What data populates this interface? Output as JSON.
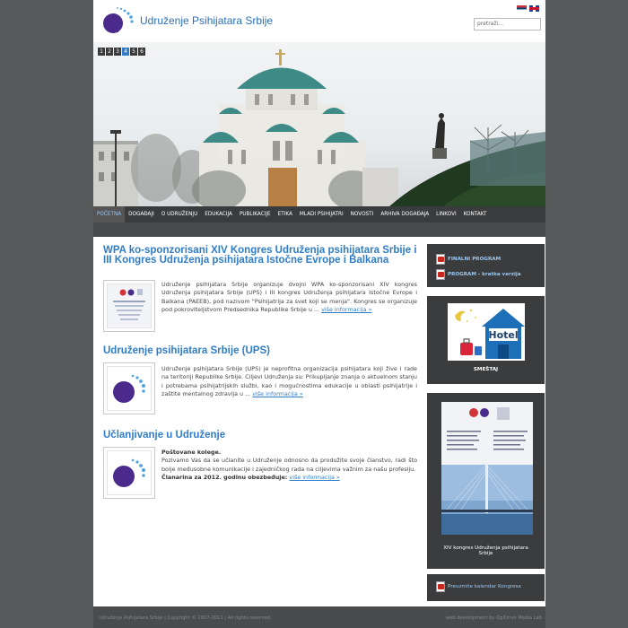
{
  "header": {
    "site_title": "Udruženje Psihijatara Srbije",
    "search_placeholder": "pretraži..."
  },
  "slider": {
    "numbers": [
      "1",
      "2",
      "3",
      "4",
      "5",
      "6"
    ],
    "active_index": 3
  },
  "nav": {
    "items": [
      "POČETNA",
      "DOGAĐAJI",
      "O UDRUŽENJU",
      "EDUKACIJA",
      "PUBLIKACIJE",
      "ETIKA",
      "MLADI PSIHIJATRI",
      "NOVOSTI",
      "ARHIVA DOGAĐAJA",
      "LINKOVI",
      "KONTAKT"
    ],
    "active": "POČETNA"
  },
  "articles": [
    {
      "title": "WPA ko-sponzorisani XIV Kongres Udruženja psihijatara Srbije i III Kongres Udruženja psihijatara Istočne Evrope i Balkana",
      "body": "Udruženje psihijatara Srbije organizuje dvojni WPA ko-sponzorisani XIV kongres Udruženja psihijatara Srbije (UPS) i III kongres Udruženja psihijatara Istočne Evrope i Balkana (PAEEB), pod nazivom \"Psihijatrija za svet koji se menja\". Kongres se organizuje pod pokroviteljstvom Predsednika Republike Srbije u ...",
      "more": "više informacija »"
    },
    {
      "title": "Udruženje psihijatara Srbije (UPS)",
      "body": "Udruženje psihijatara Srbije (UPS) je neprofitna organizacija psihijatara koji žive i rade na teritoriji Republike Srbije. Ciljevi Udruženja su: Prikupljanje znanja o aktuelnom stanju i potrebama psihijatrijskih službi, kao i mogućnostima edukacije u oblasti psihijatrije i zaštite mentalnog zdravlja u ...",
      "more": "više informacija »"
    },
    {
      "title": "Učlanjivanje u Udruženje",
      "greeting": "Poštovane kolege.",
      "body": "Pozivamo Vas da se učlanite u Udruženje odnosno da produžite svoje članstvo, radi što bolje međusobne komunikacije i zajedničkog rada na ciljevima važnim za našu profesiju.",
      "fee_label": "Članarina za 2012. godinu obezbeđuje:",
      "more": "više informacija »"
    }
  ],
  "sidebar": {
    "pdf_links": [
      {
        "title": "FINALNI PROGRAM",
        "label": ""
      },
      {
        "title": "PROGRAM",
        "label": " - kratka verzija"
      }
    ],
    "hotel_caption": "SMEŠTAJ",
    "hotel_sign": "Hotel",
    "poster_caption": "XIV kongres Udruženja psihijatara Srbije",
    "calendar_link": "Preuzmite kalendar Kongresa"
  },
  "footer": {
    "left": "Udruženje Psihijatara Srbije  |  Copyright © 2007-2011  |  All rights reserved",
    "right": "web development by OgiDrive Media Lab"
  },
  "colors": {
    "background": "#58595b",
    "accent": "#2f7dc7",
    "nav": "#3a3b3d",
    "logo_purple": "#4a2a8a"
  }
}
